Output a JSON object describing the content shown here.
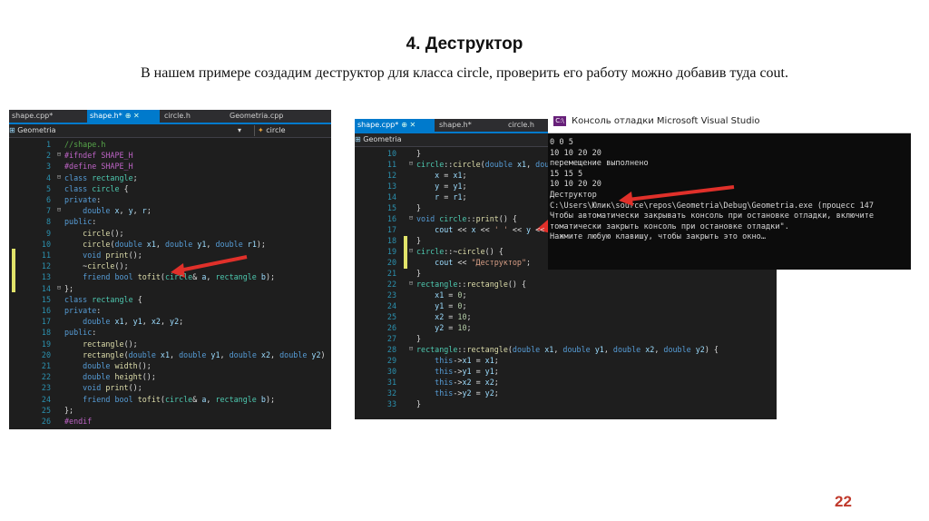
{
  "slide": {
    "title": "4. Деструктор",
    "subtitle": "В нашем примере создадим деструктор для класса circle, проверить его работу можно добавив туда cout.",
    "page_number": "22"
  },
  "editor1": {
    "tabs": [
      {
        "label": "shape.cpp*",
        "active": false,
        "close": ""
      },
      {
        "label": "shape.h*",
        "active": true,
        "close": "⊕ ✕"
      },
      {
        "label": "circle.h",
        "active": false,
        "close": ""
      },
      {
        "label": "Geometria.cpp",
        "active": false,
        "close": ""
      }
    ],
    "project": "Geometria",
    "scope": "circle",
    "first_line": 1
  },
  "editor2": {
    "tabs": [
      {
        "label": "shape.cpp*",
        "active": true,
        "close": "⊕ ✕"
      },
      {
        "label": "shape.h*",
        "active": false,
        "close": ""
      },
      {
        "label": "circle.h",
        "active": false,
        "close": ""
      }
    ],
    "project": "Geometria",
    "first_line": 10
  },
  "console": {
    "window_title": "Консоль отладки Microsoft Visual Studio",
    "lines": [
      "0 0 5",
      "10 10 20 20",
      "перемещение выполнено",
      "15 15 5",
      "10 10 20 20",
      "Деструктор",
      "C:\\Users\\Юлик\\source\\repos\\Geometria\\Debug\\Geometria.exe (процесс 147",
      "Чтобы автоматически закрывать консоль при остановке отладки, включите",
      "томатически закрыть консоль при остановке отладки\".",
      "Нажмите любую клавишу, чтобы закрыть это окно…"
    ]
  },
  "colors": {
    "arrow": "#e0302a",
    "ide_bg": "#1e1e1e",
    "tab_active": "#007acc",
    "keyword": "#569cd6",
    "type": "#4ec9b0",
    "line_number": "#2b91af",
    "page_number": "#c0392b"
  }
}
